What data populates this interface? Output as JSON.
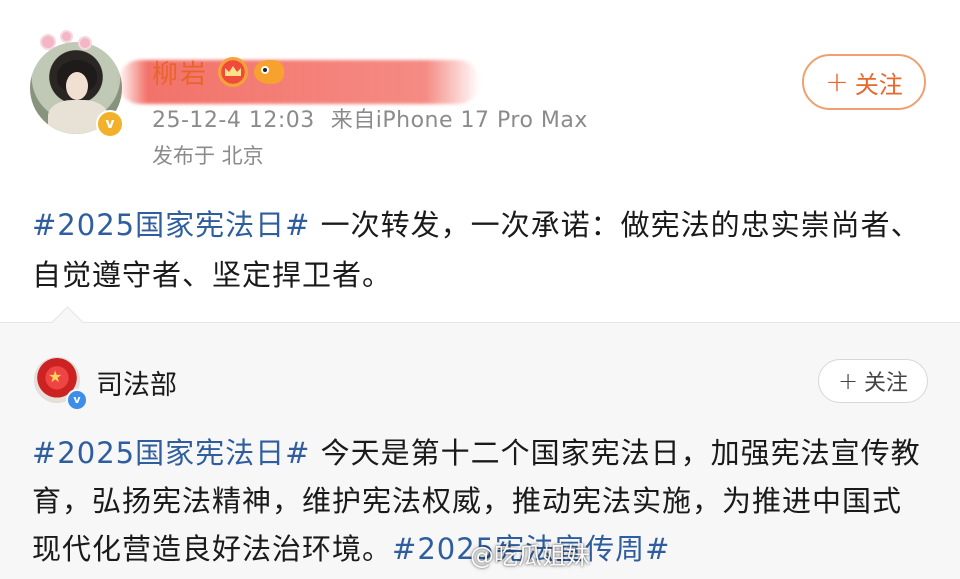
{
  "post": {
    "username": "柳岩",
    "timestamp": "25-12-4 12:03",
    "source": "来自iPhone 17 Pro Max",
    "location": "发布于 北京",
    "follow_label": "关注",
    "follow_plus": "+",
    "verified_badge": "v",
    "hashtag": "#2025国家宪法日#",
    "text": " 一次转发，一次承诺：做宪法的忠实崇尚者、自觉遵守者、坚定捍卫者。"
  },
  "repost": {
    "author": "司法部",
    "follow_label": "关注",
    "follow_plus": "+",
    "verified_badge": "v",
    "hashtag_start": "#2025国家宪法日#",
    "text": " 今天是第十二个国家宪法日，加强宪法宣传教育，弘扬宪法精神，维护宪法权威，推动宪法实施，为推进中国式现代化营造良好法治环境。",
    "hashtag_end": "#2025宪法宣传周#"
  },
  "watermark": "@吃瓜姐妹",
  "colors": {
    "hashtag": "#2f5e9e",
    "username": "#e8642a",
    "follow_accent": "#e8672a",
    "meta_gray": "#8b8b8b",
    "repost_bg": "#f7f7f7"
  }
}
